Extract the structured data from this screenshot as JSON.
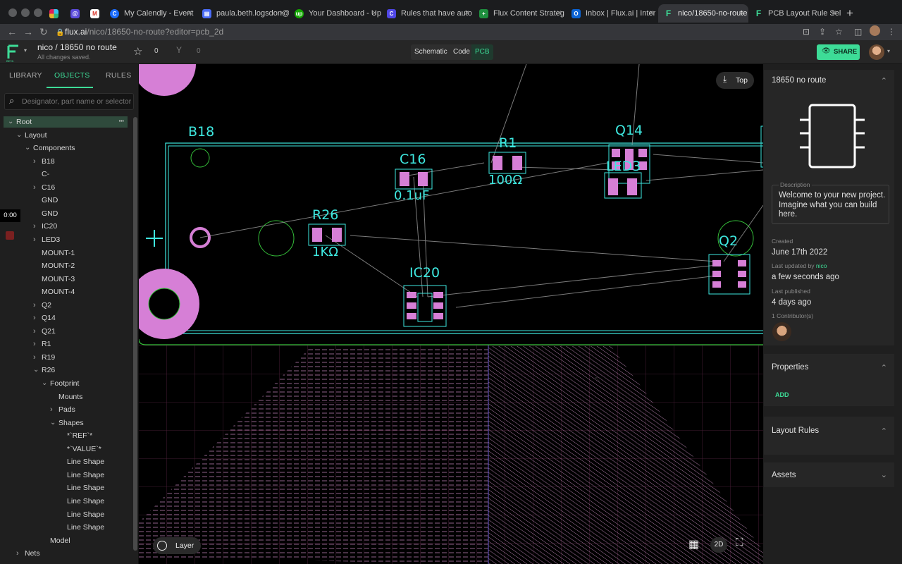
{
  "browser": {
    "tabs": [
      {
        "label": "",
        "icon": "slack-icon"
      },
      {
        "label": "",
        "icon": "at-icon"
      },
      {
        "label": "",
        "icon": "gmail-icon"
      },
      {
        "label": "My Calendly - Event",
        "icon": "calendly-icon"
      },
      {
        "label": "paula.beth.logsdon@",
        "icon": "doc-icon"
      },
      {
        "label": "Your Dashboard - Up",
        "icon": "upwork-icon"
      },
      {
        "label": "Rules that have auto",
        "icon": "c-icon"
      },
      {
        "label": "Flux Content Strateg",
        "icon": "sheets-icon"
      },
      {
        "label": "Inbox | Flux.ai | Inter",
        "icon": "outlook-icon"
      },
      {
        "label": "nico/18650-no-route",
        "icon": "flux-icon"
      },
      {
        "label": "PCB Layout Rule Sel",
        "icon": "flux-icon"
      }
    ],
    "url_host": "flux.ai",
    "url_path": "/nico/18650-no-route?editor=pcb_2d"
  },
  "app": {
    "project_title": "nico / 18650 no route",
    "save_status": "All changes saved.",
    "star_count": "0",
    "fork_count": "0",
    "modes": [
      "Schematic",
      "Code",
      "PCB"
    ],
    "active_mode": "PCB",
    "share_label": "SHARE",
    "beta_label": "BETA"
  },
  "sidebar": {
    "tabs": [
      "LIBRARY",
      "OBJECTS",
      "RULES"
    ],
    "active_tab": "OBJECTS",
    "search_placeholder": "Designator, part name or selector",
    "tree": [
      {
        "label": "Root",
        "caret": "v"
      },
      {
        "label": "Layout",
        "caret": "v"
      },
      {
        "label": "Components",
        "caret": "v"
      },
      {
        "label": "B18",
        "caret": ">"
      },
      {
        "label": "C-",
        "caret": ""
      },
      {
        "label": "C16",
        "caret": ">"
      },
      {
        "label": "GND",
        "caret": ""
      },
      {
        "label": "GND",
        "caret": ""
      },
      {
        "label": "IC20",
        "caret": ">"
      },
      {
        "label": "LED3",
        "caret": ">"
      },
      {
        "label": "MOUNT-1",
        "caret": ""
      },
      {
        "label": "MOUNT-2",
        "caret": ""
      },
      {
        "label": "MOUNT-3",
        "caret": ""
      },
      {
        "label": "MOUNT-4",
        "caret": ""
      },
      {
        "label": "Q2",
        "caret": ">"
      },
      {
        "label": "Q14",
        "caret": ">"
      },
      {
        "label": "Q21",
        "caret": ">"
      },
      {
        "label": "R1",
        "caret": ">"
      },
      {
        "label": "R19",
        "caret": ">"
      },
      {
        "label": "R26",
        "caret": "v"
      },
      {
        "label": "Footprint",
        "caret": "v"
      },
      {
        "label": "Mounts",
        "caret": ""
      },
      {
        "label": "Pads",
        "caret": ">"
      },
      {
        "label": "Shapes",
        "caret": "v"
      },
      {
        "label": "*`REF`*",
        "caret": ""
      },
      {
        "label": "*`VALUE`*",
        "caret": ""
      },
      {
        "label": "Line Shape",
        "caret": ""
      },
      {
        "label": "Line Shape",
        "caret": ""
      },
      {
        "label": "Line Shape",
        "caret": ""
      },
      {
        "label": "Line Shape",
        "caret": ""
      },
      {
        "label": "Line Shape",
        "caret": ""
      },
      {
        "label": "Line Shape",
        "caret": ""
      },
      {
        "label": "Model",
        "caret": ""
      },
      {
        "label": "Nets",
        "caret": ">"
      }
    ],
    "timer": "0:00"
  },
  "canvas": {
    "view_label": "Top",
    "layer_label": "Layer",
    "mode_2d": "2D",
    "components": [
      {
        "ref": "B18",
        "value": ""
      },
      {
        "ref": "C16",
        "value": "0.1uF"
      },
      {
        "ref": "R1",
        "value": "100Ω"
      },
      {
        "ref": "Q14",
        "value": ""
      },
      {
        "ref": "LED3",
        "value": ""
      },
      {
        "ref": "R26",
        "value": "1KΩ"
      },
      {
        "ref": "IC20",
        "value": ""
      },
      {
        "ref": "Q2",
        "value": ""
      }
    ]
  },
  "properties_panel": {
    "name": "18650 no route",
    "description_label": "Description",
    "description": "Welcome to your new project. Imagine what you can build here.",
    "created_label": "Created",
    "created": "June 17th 2022",
    "updated_label": "Last updated by",
    "updated_by": "nico",
    "updated": "a few seconds ago",
    "published_label": "Last published",
    "published": "4 days ago",
    "contributors": "1 Contributor(s)",
    "properties_title": "Properties",
    "add_label": "ADD",
    "layout_rules_title": "Layout Rules",
    "assets_title": "Assets"
  },
  "colors": {
    "accent": "#3ddc97",
    "silkscreen": "#3ee8e0",
    "pad": "#d67fd6",
    "board_outline": "#35c03a"
  }
}
